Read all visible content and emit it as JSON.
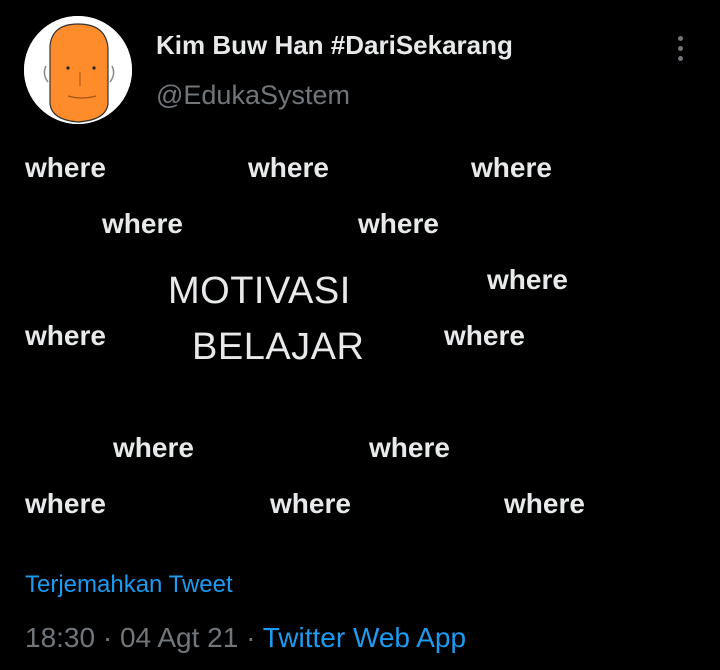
{
  "author": {
    "display_name": "Kim Buw Han #DariSekarang",
    "handle": "@EdukaSystem",
    "avatar_icon": "orange-face-avatar"
  },
  "more_icon": "more-vertical-icon",
  "tweet": {
    "word": "where",
    "headline_1": "MOTIVASI",
    "headline_2": "BELAJAR"
  },
  "translate_label": "Terjemahkan Tweet",
  "meta": {
    "time": "18:30",
    "sep1": " · ",
    "date": "04 Agt 21",
    "sep2": " · ",
    "source": "Twitter Web App"
  },
  "colors": {
    "background": "#000000",
    "text": "#e7e9ea",
    "muted": "#71767b",
    "link": "#1d9bf0",
    "avatar_face": "#ff8c2a"
  }
}
